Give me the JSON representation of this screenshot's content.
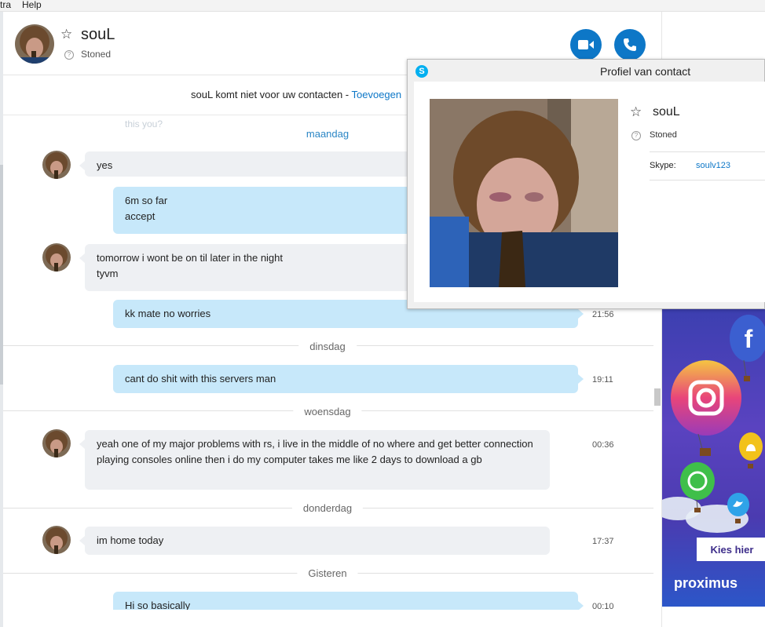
{
  "menu": {
    "items": [
      "tra",
      "Help"
    ]
  },
  "header": {
    "contact_name": "souL",
    "mood": "Stoned"
  },
  "notice": {
    "text": "souL komt niet voor uw contacten - ",
    "link": "Toevoegen"
  },
  "chat": {
    "ghost_text": "this you?",
    "days": [
      "maandag",
      "dinsdag",
      "woensdag",
      "donderdag",
      "Gisteren"
    ],
    "messages": [
      {
        "dir": "in",
        "lines": [
          "yes"
        ],
        "time": ""
      },
      {
        "dir": "out",
        "lines": [
          "6m so far",
          "accept"
        ],
        "time": ""
      },
      {
        "dir": "in",
        "lines": [
          "tomorrow i wont be on til later in the night",
          "tyvm"
        ],
        "time": ""
      },
      {
        "dir": "out",
        "lines": [
          "kk mate no worries"
        ],
        "time": "21:56"
      },
      {
        "dir": "out",
        "lines": [
          "cant do shit with this servers man"
        ],
        "time": "19:11"
      },
      {
        "dir": "in",
        "lines": [
          "yeah one of my major problems with rs, i live in the middle of no where and get better connection playing consoles online then i do my computer takes me like 2 days to download a gb"
        ],
        "time": "00:36"
      },
      {
        "dir": "in",
        "lines": [
          "im home today"
        ],
        "time": "17:37"
      },
      {
        "dir": "out",
        "lines": [
          "Hi so basically"
        ],
        "time": "00:10"
      }
    ]
  },
  "profile": {
    "window_title": "Profiel van contact",
    "name": "souL",
    "mood": "Stoned",
    "skype_label": "Skype:",
    "skype_id": "soulv123"
  },
  "ad": {
    "cta": "Kies hier",
    "brand": "proximus"
  },
  "colors": {
    "accent": "#0d77c7",
    "bubble_out": "#c7e8fa",
    "bubble_in": "#eef0f3"
  }
}
